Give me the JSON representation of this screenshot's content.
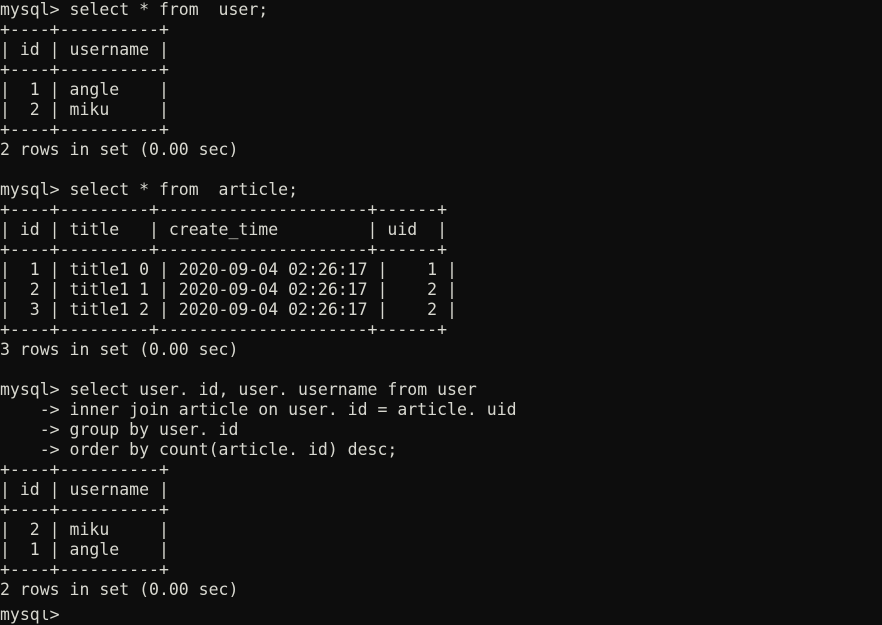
{
  "terminal": {
    "background_color": "#0d0d0d",
    "foreground_color": "#d8d8d0",
    "prompt": "mysql>",
    "continuation_prompt": "    ->",
    "lines": [
      "mysql> select * from  user;",
      "+----+----------+",
      "| id | username |",
      "+----+----------+",
      "|  1 | angle    |",
      "|  2 | miku     |",
      "+----+----------+",
      "2 rows in set (0.00 sec)",
      "",
      "mysql> select * from  article;",
      "+----+---------+---------------------+------+",
      "| id | title   | create_time         | uid  |",
      "+----+---------+---------------------+------+",
      "|  1 | title1 0 | 2020-09-04 02:26:17 |    1 |",
      "|  2 | title1 1 | 2020-09-04 02:26:17 |    2 |",
      "|  3 | title1 2 | 2020-09-04 02:26:17 |    2 |",
      "+----+---------+---------------------+------+",
      "3 rows in set (0.00 sec)",
      "",
      "mysql> select user. id, user. username from user",
      "    -> inner join article on user. id = article. uid",
      "    -> group by user. id",
      "    -> order by count(article. id) desc;",
      "+----+----------+",
      "| id | username |",
      "+----+----------+",
      "|  2 | miku     |",
      "|  1 | angle    |",
      "+----+----------+",
      "2 rows in set (0.00 sec)",
      ""
    ],
    "clipped_bottom_line": "mysql>"
  },
  "queries": [
    {
      "command": "select * from  user;",
      "result_columns": [
        "id",
        "username"
      ],
      "result_rows": [
        [
          "1",
          "angle"
        ],
        [
          "2",
          "miku"
        ]
      ],
      "status": "2 rows in set (0.00 sec)"
    },
    {
      "command": "select * from  article;",
      "result_columns": [
        "id",
        "title",
        "create_time",
        "uid"
      ],
      "result_rows": [
        [
          "1",
          "title1 0",
          "2020-09-04 02:26:17",
          "1"
        ],
        [
          "2",
          "title1 1",
          "2020-09-04 02:26:17",
          "2"
        ],
        [
          "3",
          "title1 2",
          "2020-09-04 02:26:17",
          "2"
        ]
      ],
      "status": "3 rows in set (0.00 sec)"
    },
    {
      "command_lines": [
        "select user. id, user. username from user",
        "inner join article on user. id = article. uid",
        "group by user. id",
        "order by count(article. id) desc;"
      ],
      "result_columns": [
        "id",
        "username"
      ],
      "result_rows": [
        [
          "2",
          "miku"
        ],
        [
          "1",
          "angle"
        ]
      ],
      "status": "2 rows in set (0.00 sec)"
    }
  ]
}
